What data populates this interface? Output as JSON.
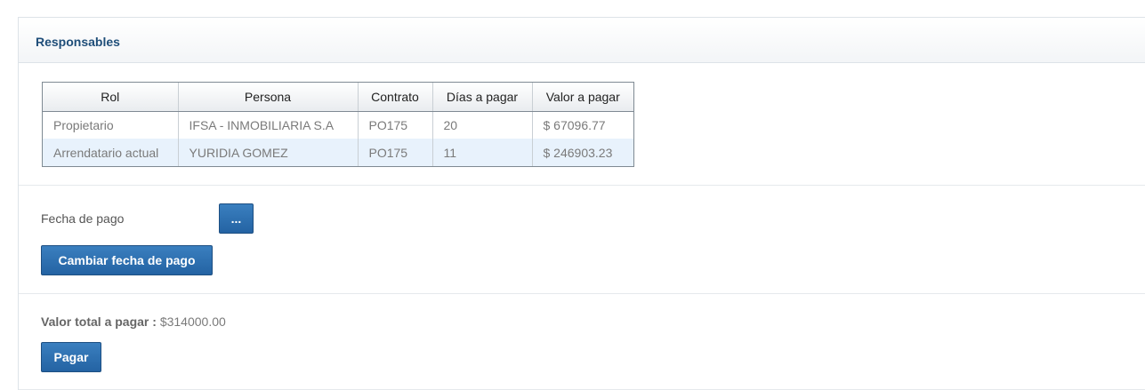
{
  "panel": {
    "title": "Responsables"
  },
  "table": {
    "headers": [
      "Rol",
      "Persona",
      "Contrato",
      "Días a pagar",
      "Valor a pagar"
    ],
    "rows": [
      [
        "Propietario",
        "IFSA - INMOBILIARIA S.A",
        "PO175",
        "20",
        "$ 67096.77"
      ],
      [
        "Arrendatario actual",
        "YURIDIA GOMEZ",
        "PO175",
        "11",
        "$ 246903.23"
      ]
    ]
  },
  "payment_date": {
    "label": "Fecha de pago",
    "picker_label": "...",
    "change_button_label": "Cambiar fecha de pago"
  },
  "total": {
    "label": "Valor total a pagar :",
    "value": "$314000.00",
    "pay_button_label": "Pagar"
  }
}
